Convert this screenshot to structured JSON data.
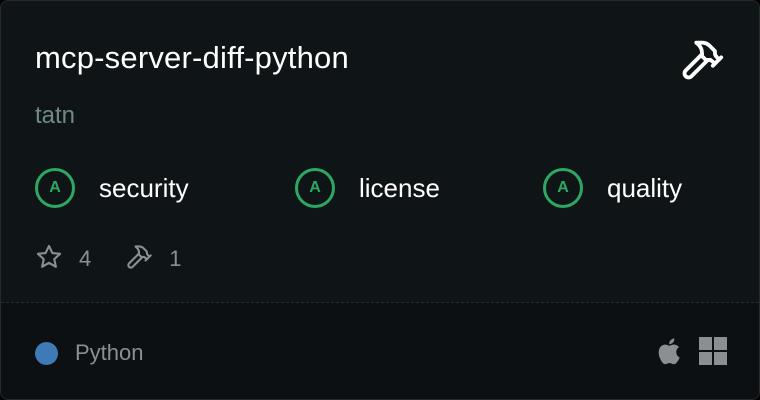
{
  "server": {
    "name": "mcp-server-diff-python",
    "author": "tatn"
  },
  "header": {
    "badge_icon": "hammer-icon"
  },
  "scores": [
    {
      "grade": "A",
      "label": "security",
      "color": "#2da864"
    },
    {
      "grade": "A",
      "label": "license",
      "color": "#2da864"
    },
    {
      "grade": "A",
      "label": "quality",
      "color": "#2da864"
    }
  ],
  "stats": {
    "stars": "4",
    "tools": "1"
  },
  "footer": {
    "language": "Python",
    "language_color": "#3f7ab8",
    "platforms": [
      "apple-icon",
      "windows-icon"
    ]
  }
}
